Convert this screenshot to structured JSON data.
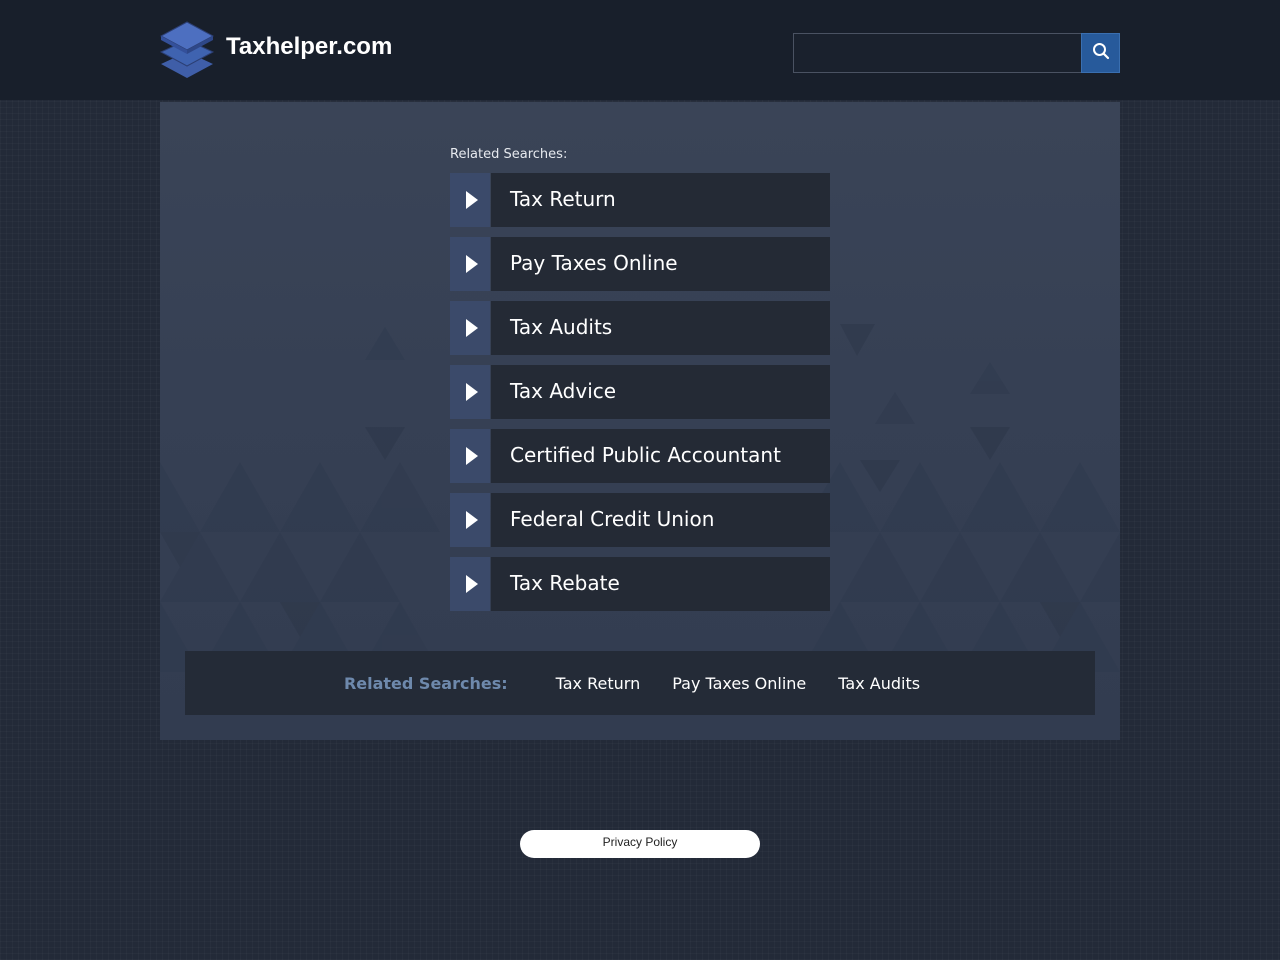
{
  "header": {
    "site_name": "Taxhelper.com",
    "logo_icon": "layers-icon",
    "search": {
      "value": "",
      "placeholder": "",
      "button_icon": "search-icon"
    }
  },
  "main": {
    "related_label": "Related Searches:",
    "arrow_icon": "play-arrow-icon",
    "links": [
      {
        "label": "Tax Return"
      },
      {
        "label": "Pay Taxes Online"
      },
      {
        "label": "Tax Audits"
      },
      {
        "label": "Tax Advice"
      },
      {
        "label": "Certified Public Accountant"
      },
      {
        "label": "Federal Credit Union"
      },
      {
        "label": "Tax Rebate"
      }
    ]
  },
  "footer_bar": {
    "label": "Related Searches:",
    "links": [
      {
        "label": "Tax Return"
      },
      {
        "label": "Pay Taxes Online"
      },
      {
        "label": "Tax Audits"
      }
    ]
  },
  "privacy": {
    "label": "Privacy Policy"
  },
  "colors": {
    "background": "#232a38",
    "header": "#181f2b",
    "panel": "#364054",
    "link_box": "#242a35",
    "arrow_box": "#3b4a6a",
    "search_button": "#275a9b",
    "footer_label": "#6e89ac"
  }
}
